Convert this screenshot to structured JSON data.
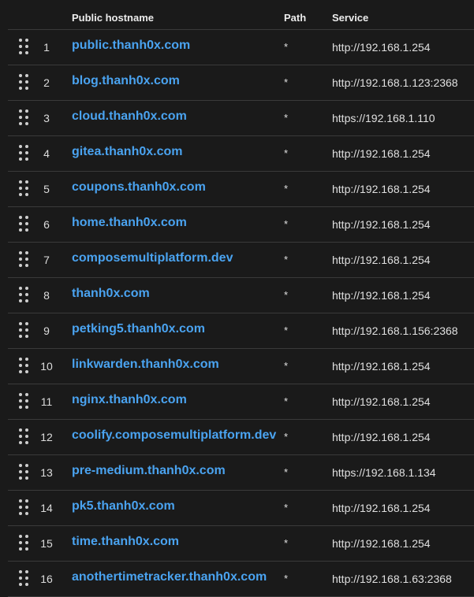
{
  "table": {
    "columns": {
      "hostname": "Public hostname",
      "path": "Path",
      "service": "Service"
    },
    "rows": [
      {
        "num": "1",
        "hostname": "public.thanh0x.com",
        "path": "*",
        "service": "http://192.168.1.254"
      },
      {
        "num": "2",
        "hostname": "blog.thanh0x.com",
        "path": "*",
        "service": "http://192.168.1.123:2368"
      },
      {
        "num": "3",
        "hostname": "cloud.thanh0x.com",
        "path": "*",
        "service": "https://192.168.1.110"
      },
      {
        "num": "4",
        "hostname": "gitea.thanh0x.com",
        "path": "*",
        "service": "http://192.168.1.254"
      },
      {
        "num": "5",
        "hostname": "coupons.thanh0x.com",
        "path": "*",
        "service": "http://192.168.1.254"
      },
      {
        "num": "6",
        "hostname": "home.thanh0x.com",
        "path": "*",
        "service": "http://192.168.1.254"
      },
      {
        "num": "7",
        "hostname": "composemultiplatform.dev",
        "path": "*",
        "service": "http://192.168.1.254"
      },
      {
        "num": "8",
        "hostname": "thanh0x.com",
        "path": "*",
        "service": "http://192.168.1.254"
      },
      {
        "num": "9",
        "hostname": "petking5.thanh0x.com",
        "path": "*",
        "service": "http://192.168.1.156:2368"
      },
      {
        "num": "10",
        "hostname": "linkwarden.thanh0x.com",
        "path": "*",
        "service": "http://192.168.1.254"
      },
      {
        "num": "11",
        "hostname": "nginx.thanh0x.com",
        "path": "*",
        "service": "http://192.168.1.254"
      },
      {
        "num": "12",
        "hostname": "coolify.composemultiplatform.dev",
        "path": "*",
        "service": "http://192.168.1.254"
      },
      {
        "num": "13",
        "hostname": "pre-medium.thanh0x.com",
        "path": "*",
        "service": "https://192.168.1.134"
      },
      {
        "num": "14",
        "hostname": "pk5.thanh0x.com",
        "path": "*",
        "service": "http://192.168.1.254"
      },
      {
        "num": "15",
        "hostname": "time.thanh0x.com",
        "path": "*",
        "service": "http://192.168.1.254"
      },
      {
        "num": "16",
        "hostname": "anothertimetracker.thanh0x.com",
        "path": "*",
        "service": "http://192.168.1.63:2368"
      }
    ]
  }
}
